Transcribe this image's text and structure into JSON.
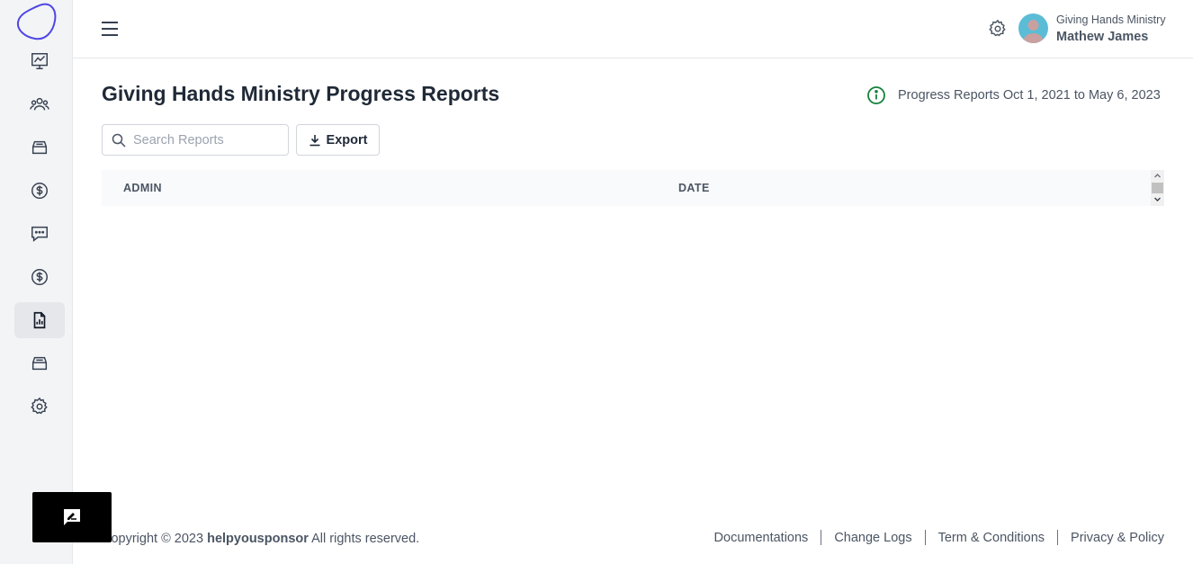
{
  "sidebar": {
    "logo": "blob-logo",
    "items": [
      {
        "icon": "chart-line-icon",
        "active": false
      },
      {
        "icon": "users-group-icon",
        "active": false
      },
      {
        "icon": "inbox-stack-icon",
        "active": false
      },
      {
        "icon": "dollar-circle-icon",
        "active": false
      },
      {
        "icon": "chat-bubble-icon",
        "active": false
      },
      {
        "icon": "dollar-circle-icon",
        "active": false
      },
      {
        "icon": "report-doc-icon",
        "active": true
      },
      {
        "icon": "inbox-stack-icon",
        "active": false
      },
      {
        "icon": "gear-icon",
        "active": false
      }
    ]
  },
  "header": {
    "org_name": "Giving Hands Ministry",
    "user_name": "Mathew James"
  },
  "main": {
    "title": "Giving Hands Ministry Progress Reports",
    "range_text": "Progress Reports Oct 1, 2021 to May 6, 2023",
    "search_placeholder": "Search Reports",
    "export_label": "Export",
    "columns": [
      "ADMIN",
      "DATE"
    ],
    "rows": []
  },
  "footer": {
    "copyright_prefix": "Copyright © 2023",
    "brand": "helpyousponsor",
    "copyright_suffix": "All rights reserved.",
    "links": [
      "Documentations",
      "Change Logs",
      "Term & Conditions",
      "Privacy & Policy"
    ]
  },
  "colors": {
    "accent": "#4f46e5",
    "info_green": "#15803d",
    "avatar_bg": "#5bbcd6"
  }
}
